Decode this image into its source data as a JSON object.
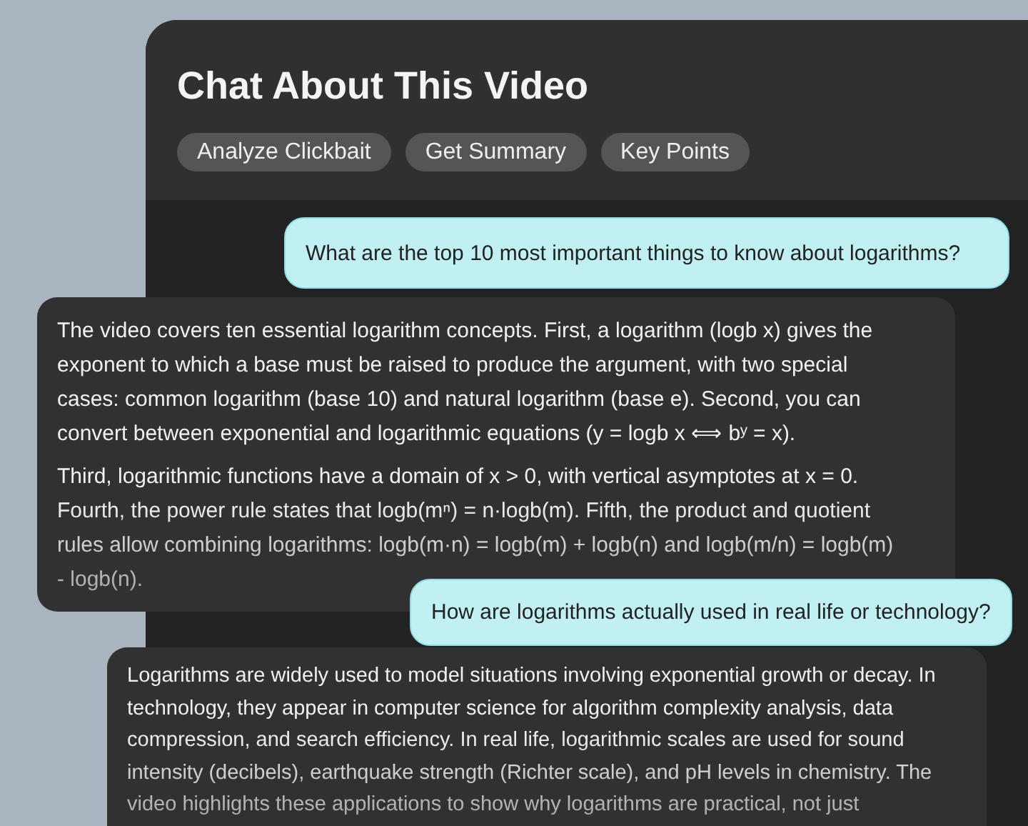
{
  "header": {
    "title": "Chat About This Video",
    "actions": [
      "Analyze Clickbait",
      "Get Summary",
      "Key Points"
    ]
  },
  "messages": [
    {
      "kind": "user",
      "paragraphs": [
        "What are the top 10 most important things to know about logarithms?"
      ]
    },
    {
      "kind": "assistant",
      "paragraphs": [
        "The video covers ten essential logarithm concepts. First, a logarithm (logb x) gives the exponent to which a base must be raised to produce the argument, with two special cases: common logarithm (base 10) and natural logarithm (base e). Second, you can convert between exponential and logarithmic equations (y = logb x ⟺ bʸ = x).",
        "Third, logarithmic functions have a domain of x > 0, with vertical asymptotes at x = 0. Fourth, the power rule states that logb(mⁿ) = n·logb(m). Fifth, the product and quotient rules allow combining logarithms: logb(m·n) = logb(m) + logb(n) and logb(m/n) = logb(m) - logb(n)."
      ]
    },
    {
      "kind": "user",
      "paragraphs": [
        "How are logarithms actually used in real life or technology?"
      ]
    },
    {
      "kind": "assistant",
      "paragraphs": [
        "Logarithms are widely used to model situations involving exponential growth or decay. In technology, they appear in computer science for algorithm complexity analysis, data compression, and search efficiency. In real life, logarithmic scales are used for sound intensity (decibels), earthquake strength (Richter scale), and pH levels in chemistry. The video highlights these applications to show why logarithms are practical, not just"
      ]
    }
  ]
}
